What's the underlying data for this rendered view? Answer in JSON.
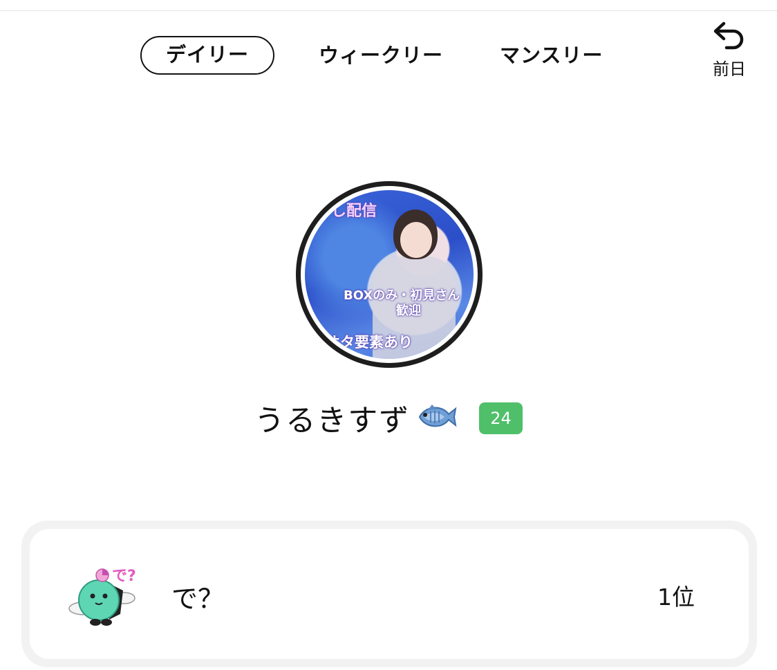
{
  "tabs": [
    {
      "label": "デイリー",
      "active": true
    },
    {
      "label": "ウィークリー",
      "active": false
    },
    {
      "label": "マンスリー",
      "active": false
    }
  ],
  "prev_day": {
    "label": "前日",
    "icon": "undo-arrow-icon"
  },
  "avatar": {
    "image_text": [
      "し配信",
      "BOXのみ・初見さん",
      "歓迎",
      "オタ要素あり"
    ]
  },
  "user": {
    "name": "うるきすず",
    "emoji": "fish-icon",
    "level": "24",
    "level_color": "#4fbf6a"
  },
  "ranking": {
    "label": "で？",
    "position": "1位",
    "mascot_text": "で?"
  }
}
